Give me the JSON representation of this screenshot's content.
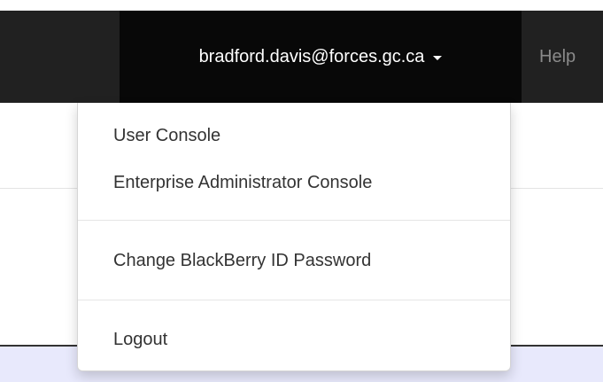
{
  "navbar": {
    "user_email": "bradford.davis@forces.gc.ca",
    "help_label": "Help"
  },
  "user_menu": {
    "items": [
      {
        "label": "User Console"
      },
      {
        "label": "Enterprise Administrator Console"
      },
      {
        "label": "Change BlackBerry ID Password"
      },
      {
        "label": "Logout"
      }
    ]
  },
  "colors": {
    "navbar_bg": "#212121",
    "active_nav_bg": "#080808",
    "nav_text": "#ffffff",
    "muted_nav_text": "#8a8a8a",
    "menu_text": "#333333",
    "band_bg": "#e8e9fc"
  },
  "icons": {
    "user_dropdown": "caret-down-icon"
  }
}
